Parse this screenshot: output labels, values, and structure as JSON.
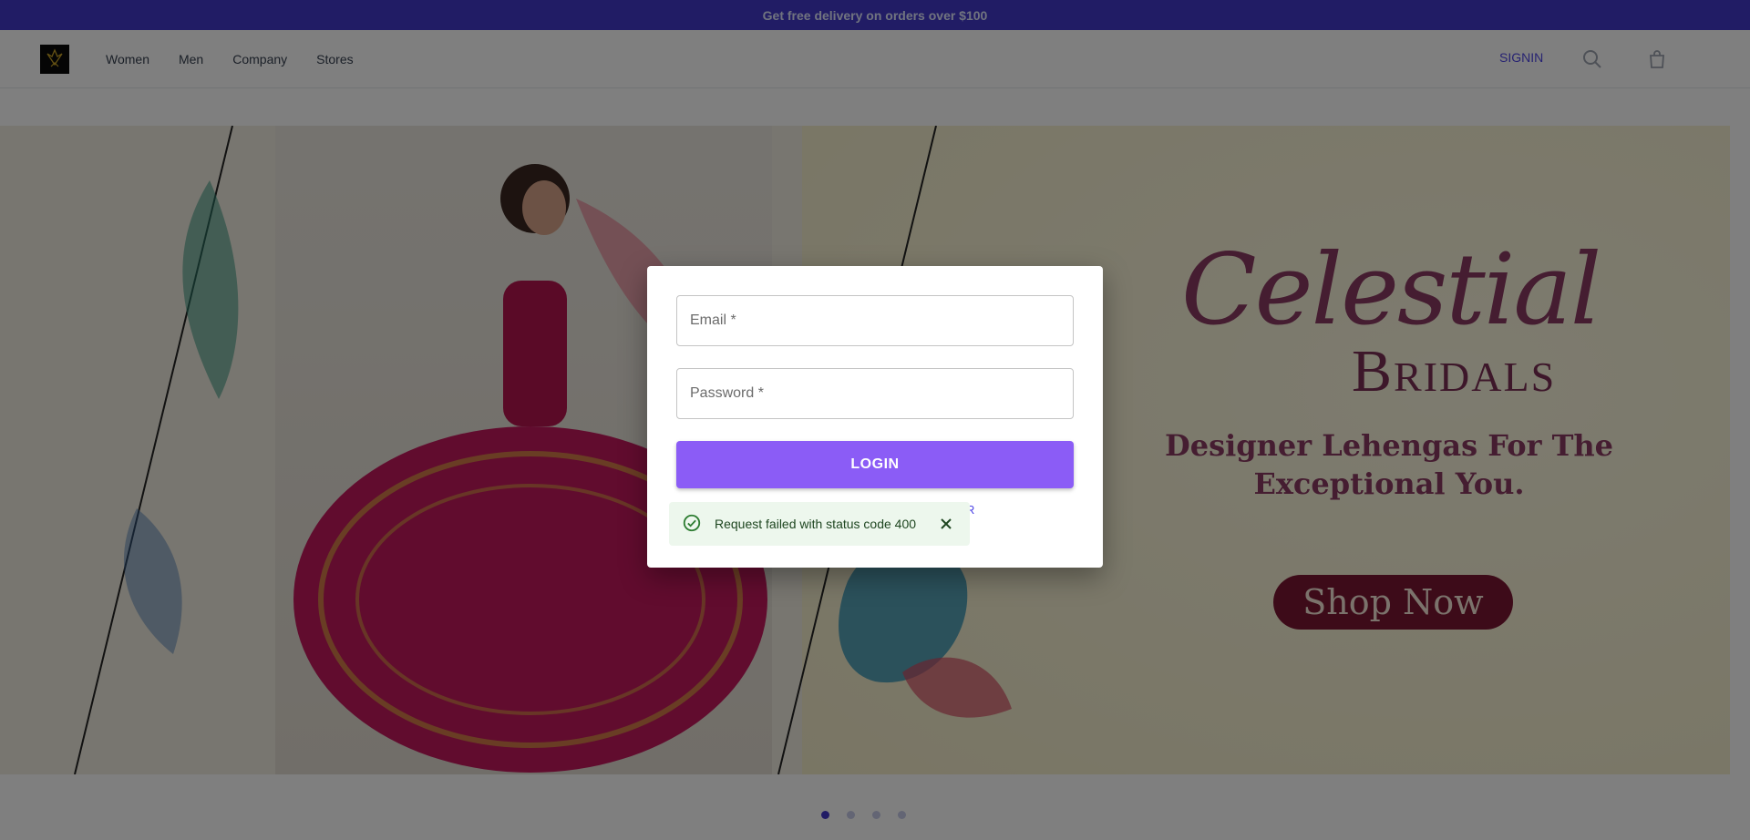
{
  "promo": {
    "text": "Get free delivery on orders over $100"
  },
  "nav": {
    "logo_icon": "phoenix-logo-icon",
    "links": [
      {
        "label": "Women"
      },
      {
        "label": "Men"
      },
      {
        "label": "Company"
      },
      {
        "label": "Stores"
      }
    ],
    "signin": "SIGNIN",
    "search_icon": "search-icon",
    "bag_icon": "shopping-bag-icon"
  },
  "hero": {
    "brand_script": "Celestial",
    "brand_sub_initial": "B",
    "brand_sub_rest": "RIDALS",
    "tagline": "Designer Lehengas For The Exceptional You.",
    "cta": "Shop Now",
    "slides_count": 4,
    "active_slide": 1
  },
  "modal": {
    "email_placeholder": "Email *",
    "password_placeholder": "Password *",
    "login_label": "LOGIN",
    "link_partial": "R"
  },
  "toast": {
    "message": "Request failed with status code 400",
    "icon": "check-circle-icon",
    "close_icon": "close-icon",
    "accent": "#2e7d32"
  },
  "colors": {
    "promo": "#4338ca",
    "login_button": "#8b5cf6",
    "brand": "#8b3a62"
  }
}
